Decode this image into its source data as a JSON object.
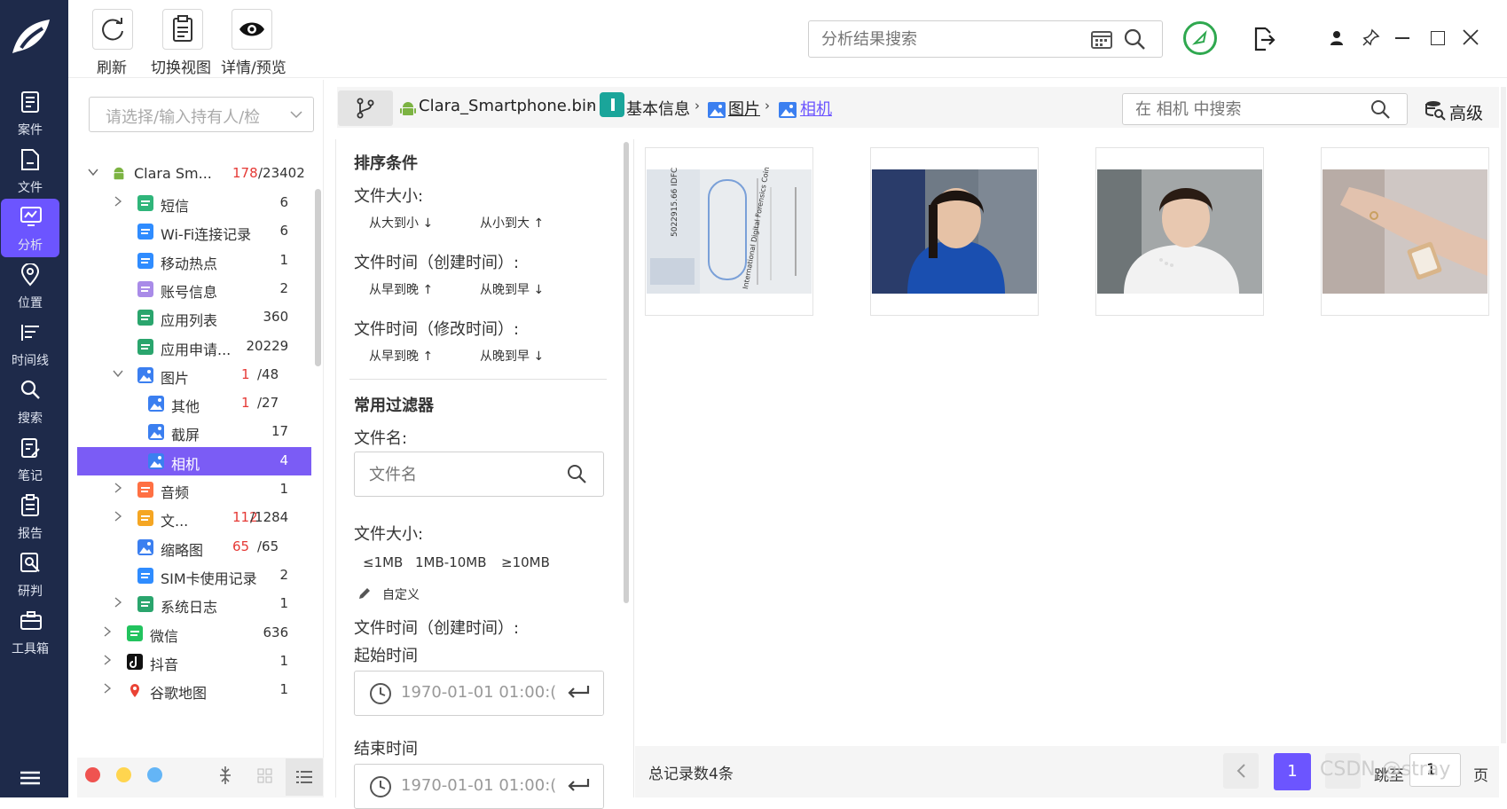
{
  "toolbar": {
    "refresh_label": "刷新",
    "switch_view_label": "切换视图",
    "detail_label": "详情/预览",
    "search_placeholder": "分析结果搜索"
  },
  "rail": {
    "items": [
      {
        "label": "案件",
        "icon": "case-icon"
      },
      {
        "label": "文件",
        "icon": "file-icon"
      },
      {
        "label": "分析",
        "icon": "analysis-icon"
      },
      {
        "label": "位置",
        "icon": "location-icon"
      },
      {
        "label": "时间线",
        "icon": "timeline-icon"
      },
      {
        "label": "搜索",
        "icon": "search-icon"
      },
      {
        "label": "笔记",
        "icon": "note-icon"
      },
      {
        "label": "报告",
        "icon": "report-icon"
      },
      {
        "label": "研判",
        "icon": "judge-icon"
      },
      {
        "label": "工具箱",
        "icon": "toolbox-icon"
      }
    ],
    "active_index": 2
  },
  "owner_select": {
    "placeholder": "请选择/输入持有人/检"
  },
  "tree": {
    "root": {
      "label": "Clara Sm...",
      "count_red": "178",
      "count": "/23402"
    },
    "items": [
      {
        "label": "短信",
        "count": "6",
        "icon": "sms-icon"
      },
      {
        "label": "Wi-Fi连接记录",
        "count": "6",
        "icon": "wifi-icon"
      },
      {
        "label": "移动热点",
        "count": "1",
        "icon": "hotspot-icon"
      },
      {
        "label": "账号信息",
        "count": "2",
        "icon": "account-icon"
      },
      {
        "label": "应用列表",
        "count": "360",
        "icon": "app-list-icon"
      },
      {
        "label": "应用申请...",
        "count": "20229",
        "icon": "app-request-icon"
      },
      {
        "label": "图片",
        "count_red": "1",
        "count": "/48",
        "icon": "image-icon"
      },
      {
        "label": "其他",
        "count_red": "1",
        "count": "/27",
        "icon": "image-icon"
      },
      {
        "label": "截屏",
        "count": "17",
        "icon": "image-icon"
      },
      {
        "label": "相机",
        "count": "4",
        "icon": "image-icon"
      },
      {
        "label": "音频",
        "count": "1",
        "icon": "audio-icon"
      },
      {
        "label": "文...",
        "count_red": "112",
        "count": "/1284",
        "icon": "document-icon"
      },
      {
        "label": "缩略图",
        "count_red": "65",
        "count": "/65",
        "icon": "thumbnail-icon"
      },
      {
        "label": "SIM卡使用记录",
        "count": "2",
        "icon": "sim-icon"
      },
      {
        "label": "系统日志",
        "count": "1",
        "icon": "log-icon"
      },
      {
        "label": "微信",
        "count": "636",
        "icon": "wechat-icon"
      },
      {
        "label": "抖音",
        "count": "1",
        "icon": "douyin-icon"
      },
      {
        "label": "谷歌地图",
        "count": "1",
        "icon": "google-maps-icon"
      }
    ]
  },
  "breadcrumb": {
    "items": [
      "Clara_Smartphone.bin",
      "基本信息",
      "图片",
      "相机"
    ],
    "search_placeholder": "在 相机 中搜索",
    "advanced_label": "高级"
  },
  "filters": {
    "sort_title": "排序条件",
    "size_label": "文件大小:",
    "size_desc": "从大到小",
    "size_asc": "从小到大",
    "ctime_label": "文件时间（创建时间）:",
    "mtime_label": "文件时间（修改时间）:",
    "early_to_late": "从早到晚",
    "late_to_early": "从晚到早",
    "common_title": "常用过滤器",
    "filename_label": "文件名:",
    "filename_placeholder": "文件名",
    "size_label2": "文件大小:",
    "size_options": [
      "≤1MB",
      "1MB-10MB",
      "≥10MB"
    ],
    "custom_label": "自定义",
    "ctime_label2": "文件时间（创建时间）:",
    "start_label": "起始时间",
    "start_value": "1970-01-01 01:00:(",
    "end_label": "结束时间",
    "end_value": "1970-01-01 01:00:("
  },
  "thumb_texts": {
    "t1": "5022915.66 IDFC",
    "t2": "International Digital Forensics Coin"
  },
  "footer": {
    "total": "总记录数4条",
    "page": "1",
    "goto_label": "跳至",
    "goto_value": "1",
    "page_suffix": "页",
    "watermark": "CSDN @stray"
  },
  "colors": {
    "rail_bg": "#1e2a4a",
    "accent": "#6c55ff",
    "selected_row": "#7b5cf5",
    "count_red": "#e53935",
    "link_blue": "#3b7ff0",
    "ok_green": "#2fa84f"
  }
}
